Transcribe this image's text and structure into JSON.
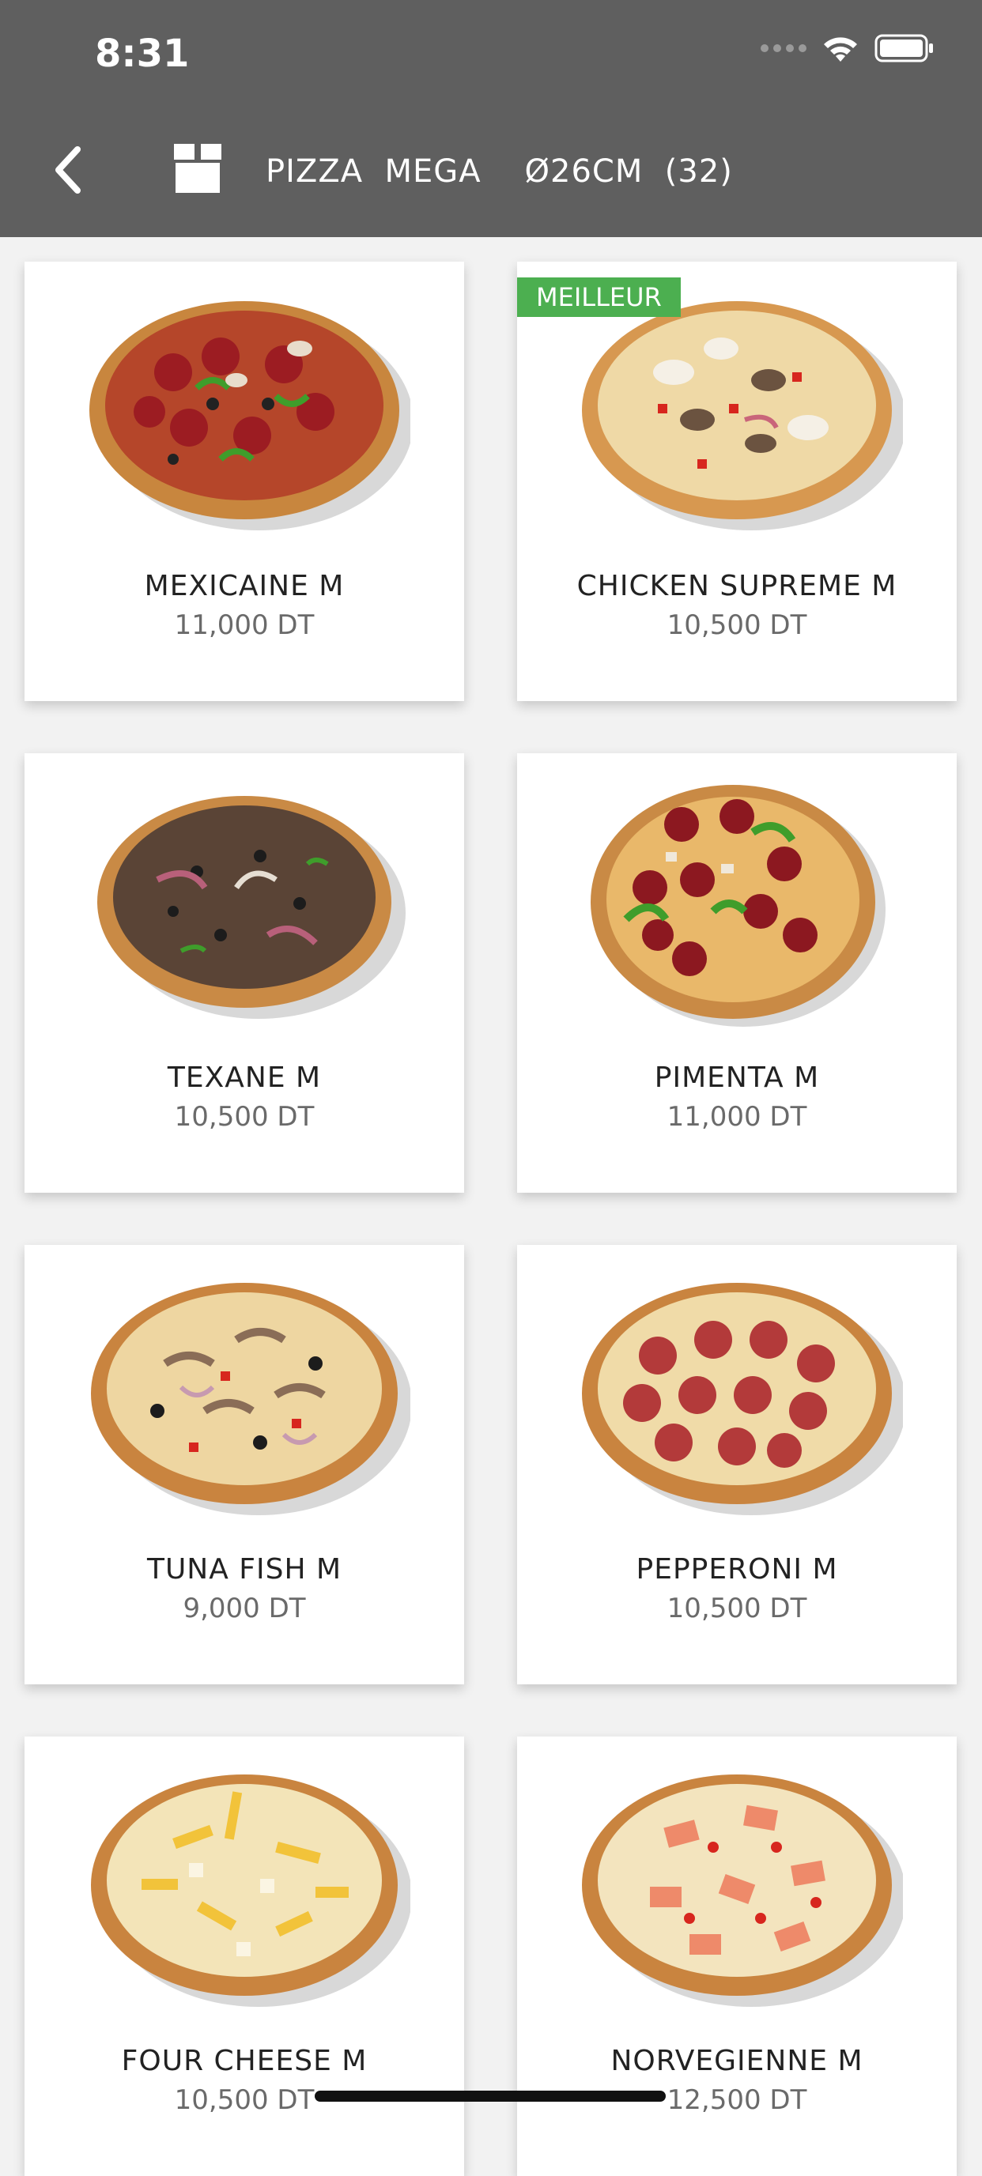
{
  "status_bar": {
    "time": "8:31"
  },
  "header": {
    "title": "PIZZA  MEGA    Ø26CM  (32)",
    "back_icon": "chevron-left-icon",
    "category_icon": "box-icon"
  },
  "colors": {
    "header_bg": "#5f5f5f",
    "badge_bg": "#4caf50",
    "card_bg": "#ffffff",
    "page_bg": "#f2f2f2"
  },
  "products": [
    {
      "name": "MEXICAINE  M",
      "price": "11,000  DT",
      "badge": ""
    },
    {
      "name": "CHICKEN  SUPREME  M",
      "price": "10,500  DT",
      "badge": "MEILLEUR"
    },
    {
      "name": "TEXANE  M",
      "price": "10,500  DT",
      "badge": ""
    },
    {
      "name": "PIMENTA  M",
      "price": "11,000  DT",
      "badge": ""
    },
    {
      "name": "TUNA  FISH  M",
      "price": "9,000  DT",
      "badge": ""
    },
    {
      "name": "PEPPERONI  M",
      "price": "10,500  DT",
      "badge": ""
    },
    {
      "name": "FOUR  CHEESE  M",
      "price": "10,500  DT",
      "badge": ""
    },
    {
      "name": "NORVEGIENNE  M",
      "price": "12,500  DT",
      "badge": ""
    }
  ]
}
